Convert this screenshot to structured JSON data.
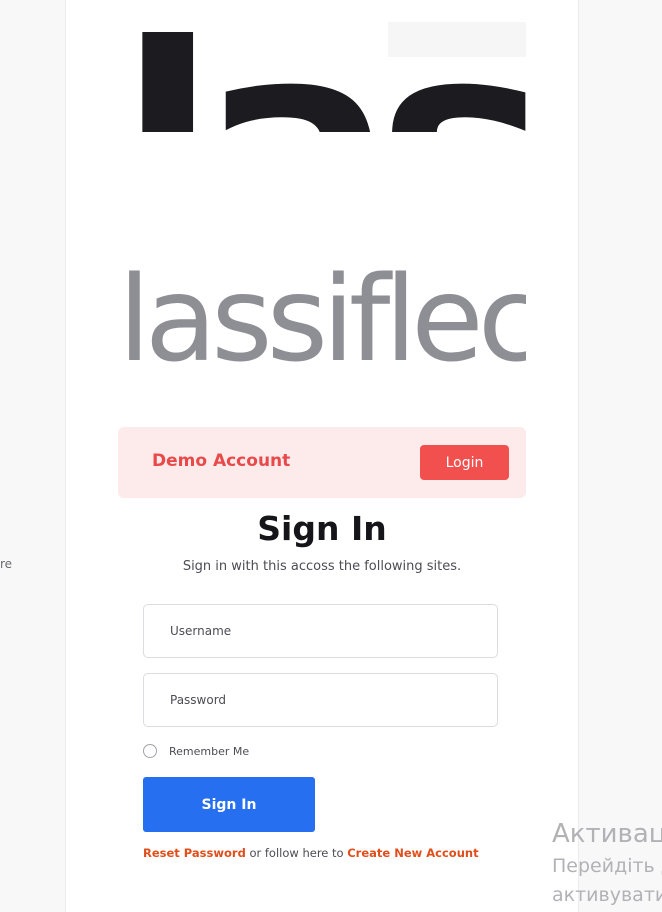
{
  "left_edge_text": "re",
  "logo": {
    "primary_text": "lass",
    "secondary_text": "lassiflec"
  },
  "demo": {
    "label": "Demo Account",
    "login_label": "Login"
  },
  "signin": {
    "title": "Sign In",
    "subtitle": "Sign in with this accoss the following sites.",
    "username_placeholder": "Username",
    "password_placeholder": "Password",
    "remember_label": "Remember Me",
    "button_label": "Sign In",
    "reset_label": "Reset Password",
    "follow_text": "or follow here to",
    "create_label": "Create New Account"
  },
  "activation": {
    "line1": "Активац",
    "line2": "Перейдіть д",
    "line3": "активувати"
  },
  "colors": {
    "accent_blue": "#256ff0",
    "demo_red": "#f1504e",
    "link_orange": "#e04e1b"
  }
}
